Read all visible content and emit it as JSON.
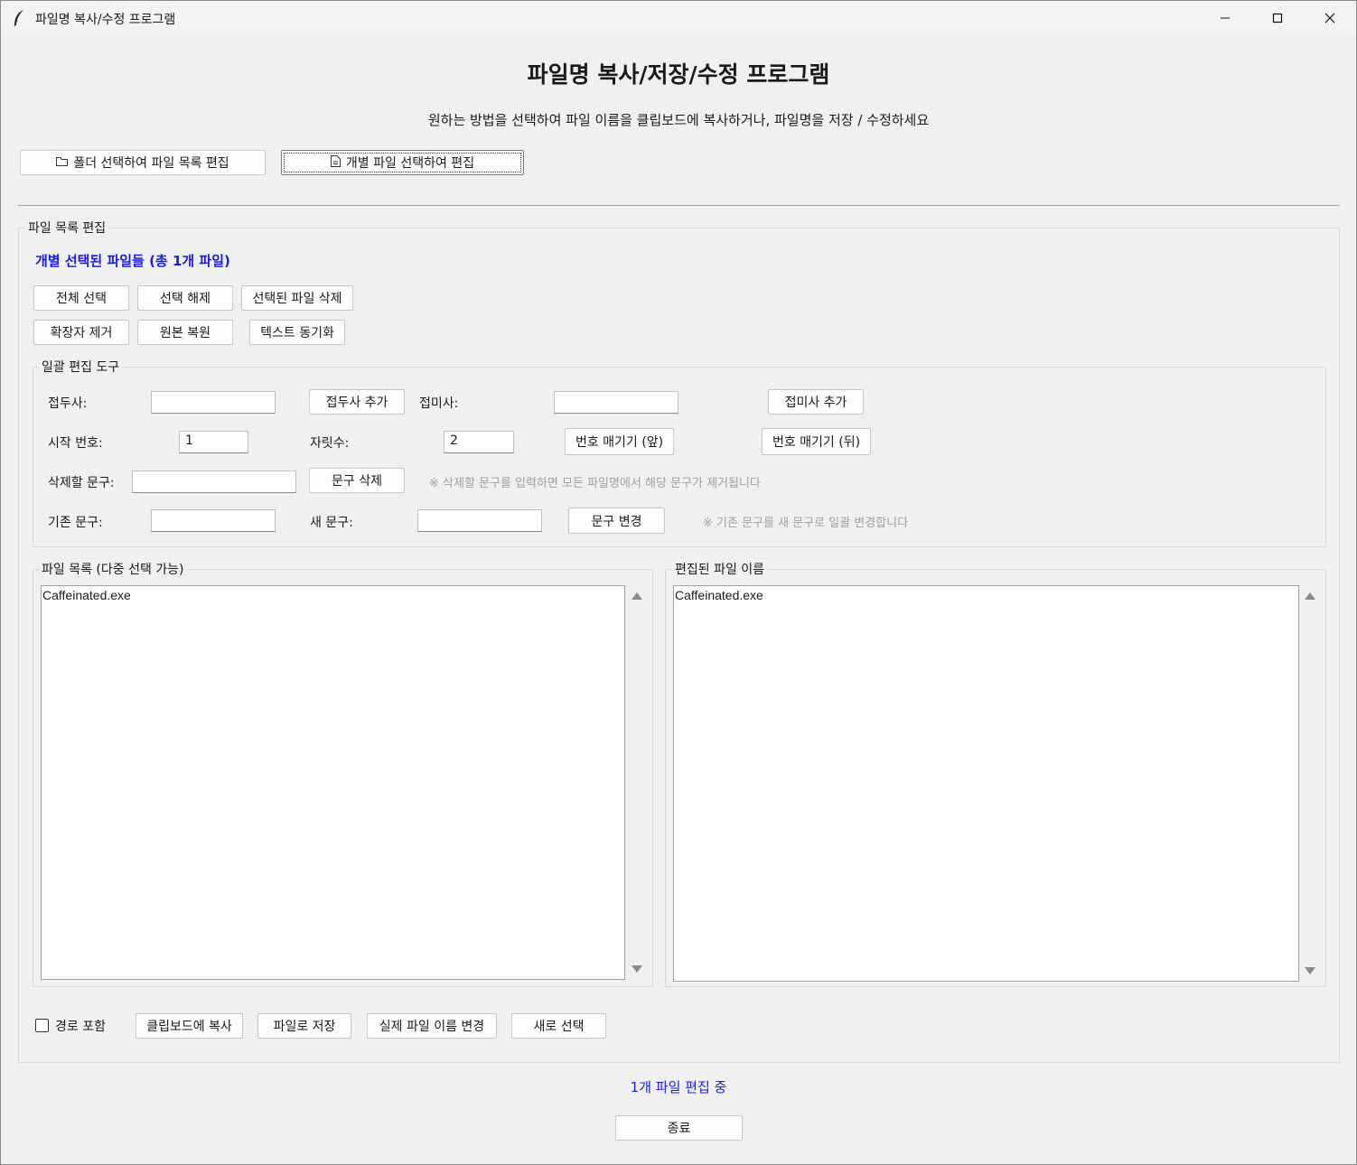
{
  "window": {
    "title": "파일명 복사/수정 프로그램"
  },
  "heading": "파일명 복사/저장/수정 프로그램",
  "subtitle": "원하는 방법을 선택하여 파일 이름을 클립보드에 복사하거나, 파일명을 저장 / 수정하세요",
  "top_buttons": {
    "folder": "폴더 선택하여 파일 목록 편집",
    "individual": "개별 파일 선택하여 편집"
  },
  "file_edit": {
    "group_label": "파일 목록 편집",
    "status": "개별 선택된 파일들 (총 1개 파일)",
    "select_all": "전체 선택",
    "deselect": "선택 해제",
    "delete_selected": "선택된 파일 삭제",
    "remove_ext": "확장자 제거",
    "restore": "원본 복원",
    "sync_text": "텍스트 동기화"
  },
  "batch": {
    "group_label": "일괄 편집 도구",
    "prefix_label": "접두사:",
    "prefix_value": "",
    "prefix_button": "접두사 추가",
    "suffix_label": "접미사:",
    "suffix_value": "",
    "suffix_button": "접미사 추가",
    "start_label": "시작 번호:",
    "start_value": "1",
    "digits_label": "자릿수:",
    "digits_value": "2",
    "number_front": "번호 매기기 (앞)",
    "number_back": "번호 매기기 (뒤)",
    "delete_label": "삭제할 문구:",
    "delete_value": "",
    "delete_button": "문구 삭제",
    "delete_hint": "※ 삭제할 문구를 입력하면 모든 파일명에서 해당 문구가 제거됩니다",
    "old_label": "기존 문구:",
    "old_value": "",
    "new_label": "새 문구:",
    "new_value": "",
    "replace_button": "문구 변경",
    "replace_hint": "※ 기존 문구를 새 문구로 일괄 변경합니다"
  },
  "lists": {
    "left_label": "파일 목록 (다중 선택 가능)",
    "left_items": [
      "Caffeinated.exe"
    ],
    "right_label": "편집된 파일 이름",
    "right_items": [
      "Caffeinated.exe"
    ]
  },
  "bottom": {
    "include_path": "경로 포함",
    "include_path_checked": false,
    "copy": "클립보드에 복사",
    "save": "파일로 저장",
    "rename": "실제 파일 이름 변경",
    "reselect": "새로 선택"
  },
  "footer": {
    "status": "1개 파일 편집 중",
    "exit": "종료"
  },
  "colors": {
    "accent": "#1a1af0",
    "background": "#f0f0f0"
  }
}
